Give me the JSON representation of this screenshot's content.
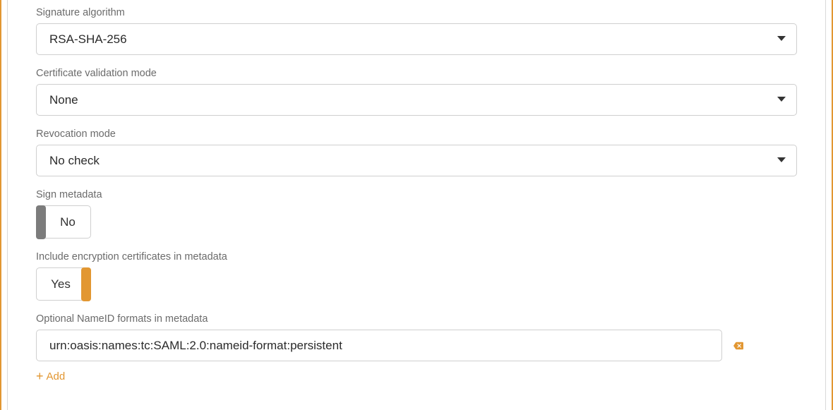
{
  "signature_algorithm": {
    "label": "Signature algorithm",
    "value": "RSA-SHA-256"
  },
  "cert_validation": {
    "label": "Certificate validation mode",
    "value": "None"
  },
  "revocation": {
    "label": "Revocation mode",
    "value": "No check"
  },
  "sign_metadata": {
    "label": "Sign metadata",
    "value": "No"
  },
  "include_encryption": {
    "label": "Include encryption certificates in metadata",
    "value": "Yes"
  },
  "nameid": {
    "label": "Optional NameID formats in metadata",
    "value": "urn:oasis:names:tc:SAML:2.0:nameid-format:persistent",
    "add_label": "Add"
  }
}
